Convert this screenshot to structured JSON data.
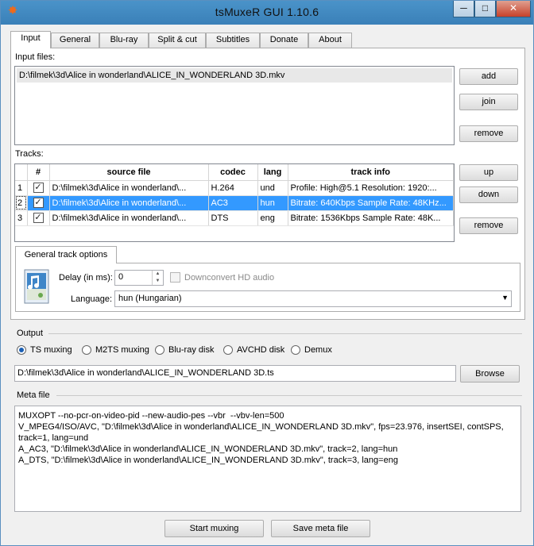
{
  "window": {
    "title": "tsMuxeR GUI 1.10.6",
    "minimize": "─",
    "maximize": "□",
    "close": "✕"
  },
  "tabs": [
    {
      "label": "Input"
    },
    {
      "label": "General"
    },
    {
      "label": "Blu-ray"
    },
    {
      "label": "Split & cut"
    },
    {
      "label": "Subtitles"
    },
    {
      "label": "Donate"
    },
    {
      "label": "About"
    }
  ],
  "input_files": {
    "label": "Input files:",
    "items": [
      "D:\\filmek\\3d\\Alice in wonderland\\ALICE_IN_WONDERLAND 3D.mkv"
    ],
    "add_label": "add",
    "join_label": "join",
    "remove_label": "remove"
  },
  "tracks": {
    "label": "Tracks:",
    "columns": [
      "#",
      "source file",
      "codec",
      "lang",
      "track info"
    ],
    "rows": [
      {
        "num": "1",
        "checked": true,
        "source": "D:\\filmek\\3d\\Alice in wonderland\\...",
        "codec": "H.264",
        "lang": "und",
        "info": "Profile: High@5.1  Resolution: 1920:..."
      },
      {
        "num": "2",
        "checked": true,
        "source": "D:\\filmek\\3d\\Alice in wonderland\\...",
        "codec": "AC3",
        "lang": "hun",
        "info": "Bitrate: 640Kbps Sample Rate: 48KHz..."
      },
      {
        "num": "3",
        "checked": true,
        "source": "D:\\filmek\\3d\\Alice in wonderland\\...",
        "codec": "DTS",
        "lang": "eng",
        "info": "Bitrate: 1536Kbps  Sample Rate: 48K..."
      }
    ],
    "up_label": "up",
    "down_label": "down",
    "remove_label": "remove"
  },
  "track_options": {
    "tab_label": "General track options",
    "delay_label": "Delay (in ms):",
    "delay_value": "0",
    "downconvert_label": "Downconvert HD audio",
    "language_label": "Language:",
    "language_value": "hun (Hungarian)"
  },
  "output": {
    "label": "Output",
    "options": [
      {
        "label": "TS muxing",
        "selected": true
      },
      {
        "label": "M2TS muxing",
        "selected": false
      },
      {
        "label": "Blu-ray disk",
        "selected": false
      },
      {
        "label": "AVCHD disk",
        "selected": false
      },
      {
        "label": "Demux",
        "selected": false
      }
    ],
    "path": "D:\\filmek\\3d\\Alice in wonderland\\ALICE_IN_WONDERLAND 3D.ts",
    "browse_label": "Browse"
  },
  "meta": {
    "label": "Meta file",
    "text": "MUXOPT --no-pcr-on-video-pid --new-audio-pes --vbr  --vbv-len=500\nV_MPEG4/ISO/AVC, \"D:\\filmek\\3d\\Alice in wonderland\\ALICE_IN_WONDERLAND 3D.mkv\", fps=23.976, insertSEI, contSPS,\ntrack=1, lang=und\nA_AC3, \"D:\\filmek\\3d\\Alice in wonderland\\ALICE_IN_WONDERLAND 3D.mkv\", track=2, lang=hun\nA_DTS, \"D:\\filmek\\3d\\Alice in wonderland\\ALICE_IN_WONDERLAND 3D.mkv\", track=3, lang=eng"
  },
  "footer": {
    "start_label": "Start muxing",
    "save_label": "Save meta file"
  }
}
